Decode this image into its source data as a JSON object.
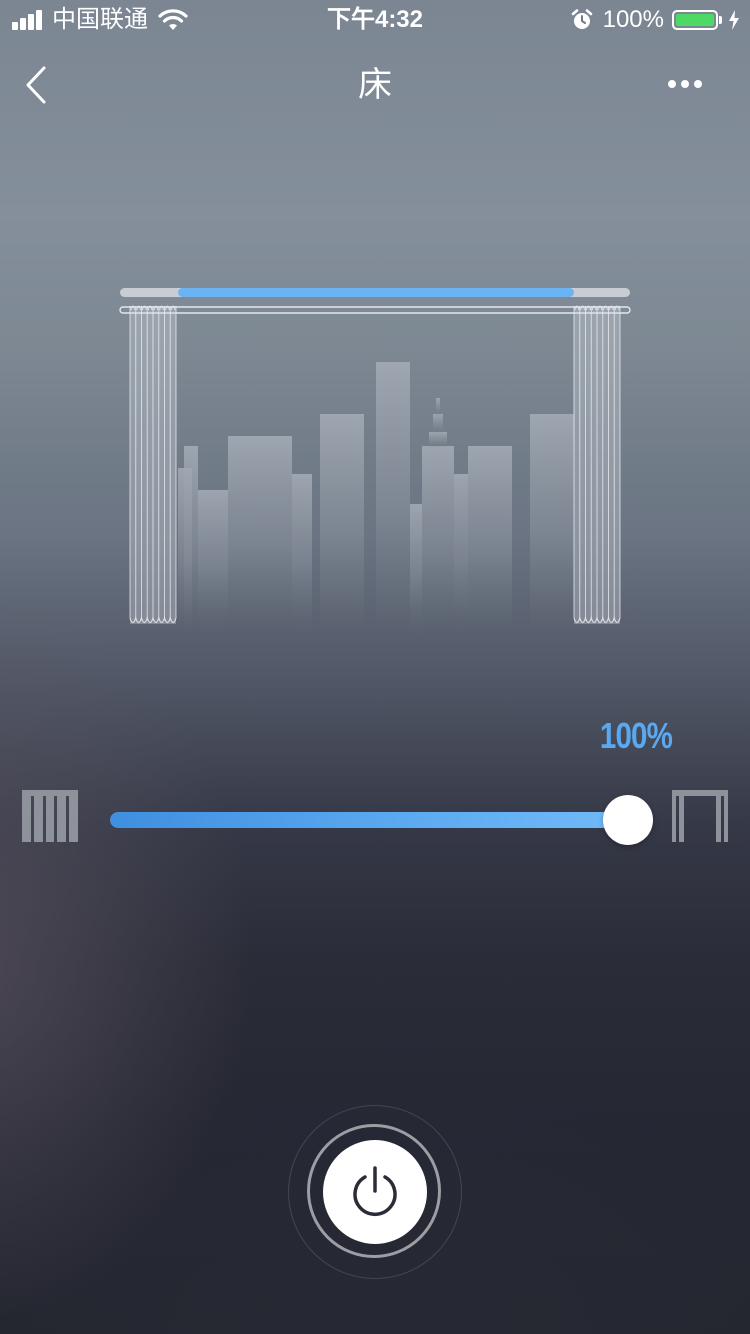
{
  "status_bar": {
    "carrier": "中国联通",
    "time": "下午4:32",
    "battery_percent": "100%",
    "battery_level": 1.0,
    "icons": [
      "signal-icon",
      "wifi-icon",
      "alarm-icon",
      "battery-icon",
      "charging-bolt-icon"
    ]
  },
  "nav": {
    "title": "床",
    "back_icon": "chevron-left-icon",
    "more_icon": "more-dots-icon"
  },
  "curtain": {
    "open_percent": "100%",
    "open_level": 1.0,
    "track_active_color": "#6ab4f3",
    "track_color": "#c9cdd3"
  },
  "controls": {
    "closed_icon": "curtain-closed-icon",
    "open_icon": "curtain-open-icon",
    "slider_color_start": "#3f8fe0",
    "slider_color_end": "#6fbaf8",
    "power_icon": "power-icon"
  }
}
